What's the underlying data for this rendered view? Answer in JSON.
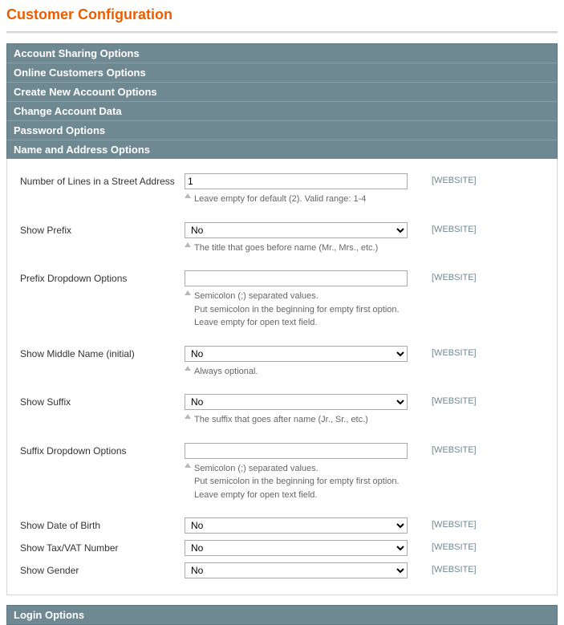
{
  "page_title": "Customer Configuration",
  "scope_label": "[WEBSITE]",
  "sections": {
    "account_sharing": "Account Sharing Options",
    "online_customers": "Online Customers Options",
    "create_account": "Create New Account Options",
    "change_account": "Change Account Data",
    "password": "Password Options",
    "name_address": "Name and Address Options",
    "login": "Login Options"
  },
  "fields": {
    "street_lines": {
      "label": "Number of Lines in a Street Address",
      "value": "1",
      "hint": "Leave empty for default (2). Valid range: 1-4"
    },
    "show_prefix": {
      "label": "Show Prefix",
      "value": "No",
      "hint": "The title that goes before name (Mr., Mrs., etc.)"
    },
    "prefix_options": {
      "label": "Prefix Dropdown Options",
      "value": "",
      "hint1": "Semicolon (;) separated values.",
      "hint2": "Put semicolon in the beginning for empty first option.",
      "hint3": "Leave empty for open text field."
    },
    "show_middle": {
      "label": "Show Middle Name (initial)",
      "value": "No",
      "hint": "Always optional."
    },
    "show_suffix": {
      "label": "Show Suffix",
      "value": "No",
      "hint": "The suffix that goes after name (Jr., Sr., etc.)"
    },
    "suffix_options": {
      "label": "Suffix Dropdown Options",
      "value": "",
      "hint1": "Semicolon (;) separated values.",
      "hint2": "Put semicolon in the beginning for empty first option.",
      "hint3": "Leave empty for open text field."
    },
    "show_dob": {
      "label": "Show Date of Birth",
      "value": "No"
    },
    "show_taxvat": {
      "label": "Show Tax/VAT Number",
      "value": "No"
    },
    "show_gender": {
      "label": "Show Gender",
      "value": "No"
    }
  }
}
